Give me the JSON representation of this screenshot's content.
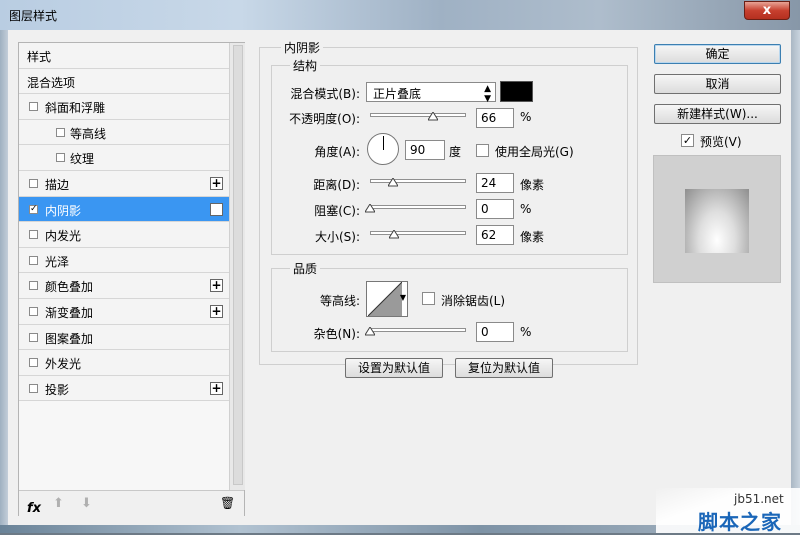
{
  "window": {
    "title": "图层样式",
    "close_glyph": "x"
  },
  "styles": [
    {
      "label": "样式",
      "checkbox": false,
      "indent": false,
      "plus": false,
      "checked": false,
      "selected": false
    },
    {
      "label": "混合选项",
      "checkbox": false,
      "indent": false,
      "plus": false,
      "checked": false,
      "selected": false
    },
    {
      "label": "斜面和浮雕",
      "checkbox": true,
      "indent": false,
      "plus": false,
      "checked": false,
      "selected": false
    },
    {
      "label": "等高线",
      "checkbox": true,
      "indent": true,
      "plus": false,
      "checked": false,
      "selected": false
    },
    {
      "label": "纹理",
      "checkbox": true,
      "indent": true,
      "plus": false,
      "checked": false,
      "selected": false
    },
    {
      "label": "描边",
      "checkbox": true,
      "indent": false,
      "plus": true,
      "checked": false,
      "selected": false
    },
    {
      "label": "内阴影",
      "checkbox": true,
      "indent": false,
      "plus": true,
      "checked": true,
      "selected": true
    },
    {
      "label": "内发光",
      "checkbox": true,
      "indent": false,
      "plus": false,
      "checked": false,
      "selected": false
    },
    {
      "label": "光泽",
      "checkbox": true,
      "indent": false,
      "plus": false,
      "checked": false,
      "selected": false
    },
    {
      "label": "颜色叠加",
      "checkbox": true,
      "indent": false,
      "plus": true,
      "checked": false,
      "selected": false
    },
    {
      "label": "渐变叠加",
      "checkbox": true,
      "indent": false,
      "plus": true,
      "checked": false,
      "selected": false
    },
    {
      "label": "图案叠加",
      "checkbox": true,
      "indent": false,
      "plus": false,
      "checked": false,
      "selected": false
    },
    {
      "label": "外发光",
      "checkbox": true,
      "indent": false,
      "plus": false,
      "checked": false,
      "selected": false
    },
    {
      "label": "投影",
      "checkbox": true,
      "indent": false,
      "plus": true,
      "checked": false,
      "selected": false
    }
  ],
  "list_footer": {
    "fx": "fx",
    "fx_caret": ".",
    "up": "⬆",
    "down": "⬇",
    "trash": "🗑"
  },
  "inner_shadow": {
    "section_title": "内阴影",
    "structure": {
      "title": "结构",
      "blend_mode_label": "混合模式(B):",
      "blend_mode_value": "正片叠底",
      "blend_color": "#000000",
      "opacity_label": "不透明度(O):",
      "opacity_value": "66",
      "opacity_unit": "%",
      "opacity_level": 0.66,
      "angle_label": "角度(A):",
      "angle_value": "90",
      "angle_unit": "度",
      "global_light_label": "使用全局光(G)",
      "global_light_checked": false,
      "distance_label": "距离(D):",
      "distance_value": "24",
      "distance_unit": "像素",
      "distance_level": 0.24,
      "choke_label": "阻塞(C):",
      "choke_value": "0",
      "choke_unit": "%",
      "choke_level": 0.0,
      "size_label": "大小(S):",
      "size_value": "62",
      "size_unit": "像素",
      "size_level": 0.25
    },
    "quality": {
      "title": "品质",
      "contour_label": "等高线:",
      "anti_alias_label": "消除锯齿(L)",
      "anti_alias_checked": false,
      "noise_label": "杂色(N):",
      "noise_value": "0",
      "noise_unit": "%",
      "noise_level": 0.0
    },
    "make_default_label": "设置为默认值",
    "reset_default_label": "复位为默认值"
  },
  "buttons": {
    "ok": "确定",
    "cancel": "取消",
    "new_style": "新建样式(W)...",
    "preview_label": "预览(V)",
    "preview_checked": true
  },
  "watermark": {
    "site": "jb51.net",
    "brand": "脚本之家"
  }
}
